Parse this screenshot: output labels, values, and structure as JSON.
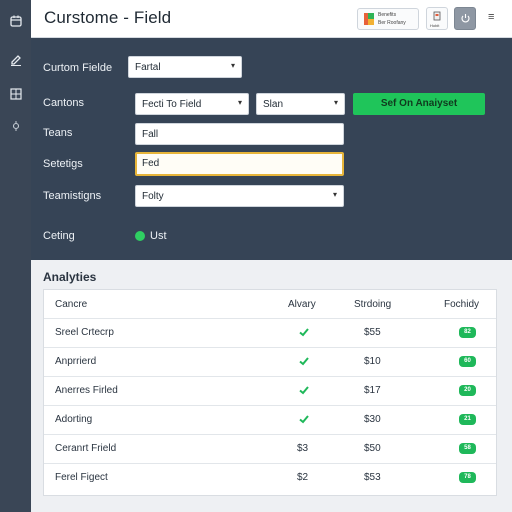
{
  "app": {
    "title": "Curstome - Field"
  },
  "header": {
    "badge_line1": "Benefits",
    "badge_line2": "Ber Roofany",
    "button_small_label": "Hobit"
  },
  "form": {
    "custom_fields": {
      "label": "Curtom Fielde",
      "value": "Fartal"
    },
    "cantions": {
      "label": "Cantons",
      "select_value": "Fecti To Field",
      "select2_value": "Slan"
    },
    "apply_button": "Sef On Anaiyset",
    "teans": {
      "label": "Teans",
      "value": "Fall"
    },
    "setetigs": {
      "label": "Setetigs",
      "value": "Fed"
    },
    "teamstigns": {
      "label": "Teamistigns",
      "value": "Folty"
    },
    "ceting": {
      "label": "Ceting",
      "status_text": "Ust"
    }
  },
  "analytics": {
    "title": "Analyties",
    "columns": [
      "Cancre",
      "Alvary",
      "Strdoing",
      "Fochidy"
    ],
    "rows": [
      {
        "name": "Sreel Crtecrp",
        "alvary": "check",
        "strdoing": "$55",
        "fochidy": "82"
      },
      {
        "name": "Anprrierd",
        "alvary": "check",
        "strdoing": "$10",
        "fochidy": "60"
      },
      {
        "name": "Anerres Firled",
        "alvary": "check",
        "strdoing": "$17",
        "fochidy": "20"
      },
      {
        "name": "Adorting",
        "alvary": "check",
        "strdoing": "$30",
        "fochidy": "21"
      },
      {
        "name": "Ceranrt Frield",
        "alvary": "$3",
        "strdoing": "$50",
        "fochidy": "58"
      },
      {
        "name": "Ferel Figect",
        "alvary": "$2",
        "strdoing": "$53",
        "fochidy": "78"
      }
    ]
  },
  "colors": {
    "accent": "#1fc55a",
    "panel": "#364456",
    "sidebar": "#3a4656",
    "focus": "#e7b53a"
  },
  "icons": {
    "sidebar": [
      "calendar-icon",
      "edit-icon",
      "grid-icon",
      "settings-icon"
    ],
    "header": [
      "flag-icon",
      "document-icon",
      "power-icon",
      "menu-icon"
    ]
  }
}
